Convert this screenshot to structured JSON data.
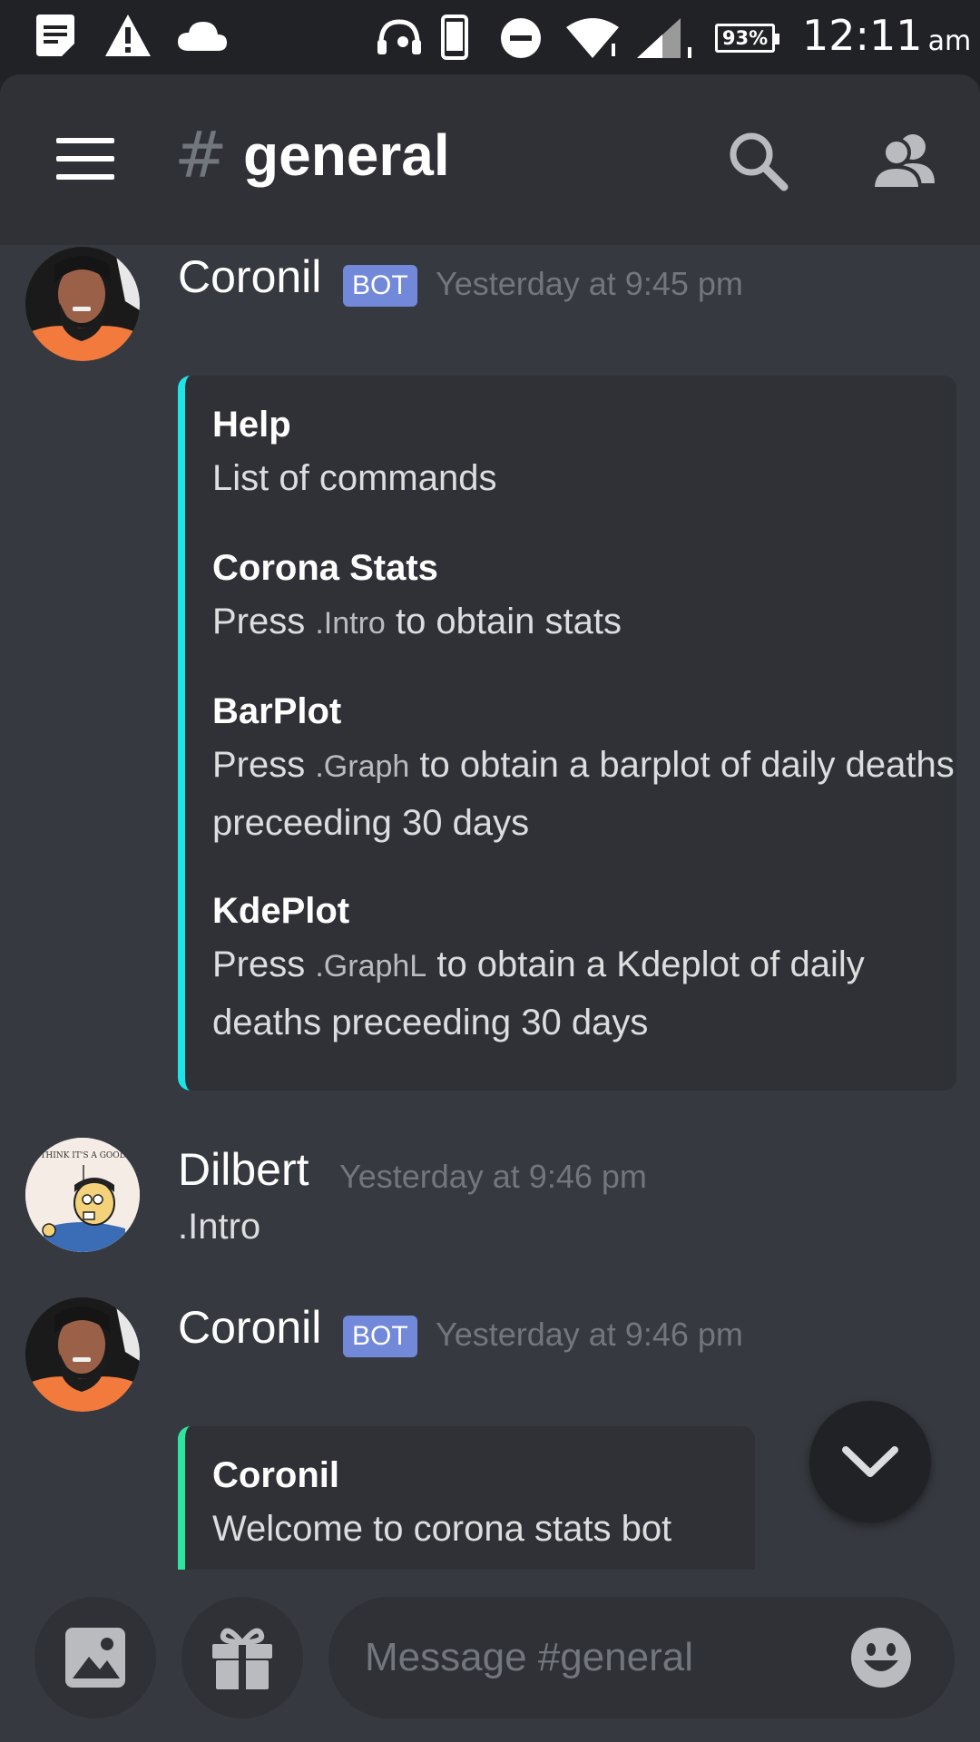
{
  "status_bar": {
    "battery": "93%",
    "time": "12:11",
    "ampm": "am"
  },
  "header": {
    "hash": "#",
    "channel": "general"
  },
  "messages": [
    {
      "author": "Coronil",
      "tag": "BOT",
      "timestamp": "Yesterday at 9:45 pm",
      "embed": {
        "color": "#1de4e6",
        "fields": [
          {
            "name": "Help",
            "value": "List of commands"
          },
          {
            "name": "Corona Stats",
            "value_pre": "Press ",
            "code": ".Intro",
            "value_post": " to obtain stats"
          },
          {
            "name": "BarPlot",
            "value_pre": "Press ",
            "code": ".Graph",
            "value_post": " to obtain a barplot of daily deaths preceeding 30 days"
          },
          {
            "name": "KdePlot",
            "value_pre": "Press ",
            "code": ".GraphL",
            "value_post": " to obtain a Kdeplot of daily deaths preceeding 30 days"
          }
        ]
      }
    },
    {
      "author": "Dilbert",
      "timestamp": "Yesterday at 9:46 pm",
      "text": ".Intro",
      "avatar_caption": "I THINK IT'S A GOOD IDEA."
    },
    {
      "author": "Coronil",
      "tag": "BOT",
      "timestamp": "Yesterday at 9:46 pm",
      "embed": {
        "color": "#2ee59d",
        "title": "Coronil",
        "description": "Welcome to corona stats bot"
      }
    }
  ],
  "composer": {
    "placeholder": "Message #general"
  }
}
